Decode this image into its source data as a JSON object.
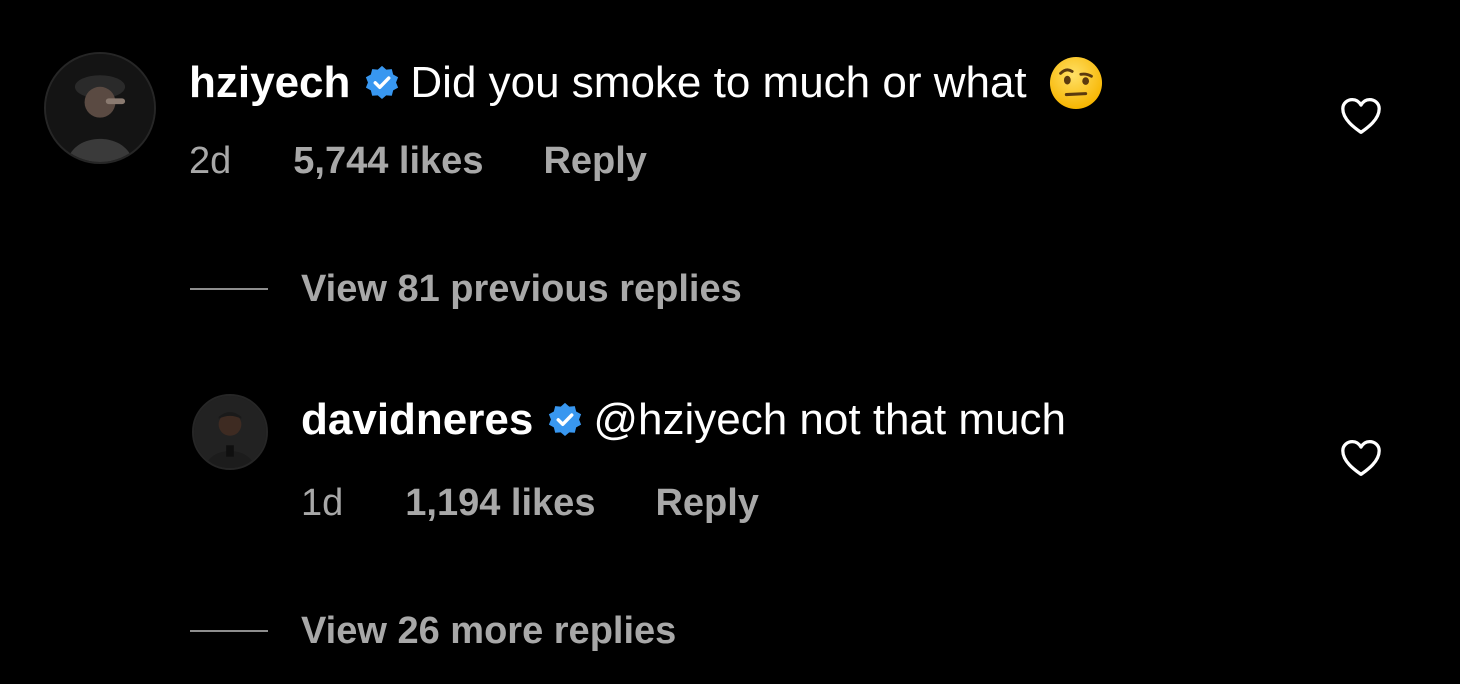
{
  "colors": {
    "background": "#000000",
    "primary_text": "#ffffff",
    "secondary_text": "#a8a8a8",
    "verified_badge": "#3897f0"
  },
  "comments": [
    {
      "username": "hziyech",
      "verified": true,
      "text": "Did you smoke to much or what",
      "emoji": "face-with-raised-eyebrow-emoji",
      "time": "2d",
      "likes": "5,744 likes",
      "reply_label": "Reply",
      "like_icon": "heart-outline-icon"
    },
    {
      "username": "davidneres",
      "verified": true,
      "text": "@hziyech not that much",
      "time": "1d",
      "likes": "1,194 likes",
      "reply_label": "Reply",
      "like_icon": "heart-outline-icon"
    }
  ],
  "view_previous_replies": "View 81 previous replies",
  "view_more_replies": "View 26 more replies"
}
